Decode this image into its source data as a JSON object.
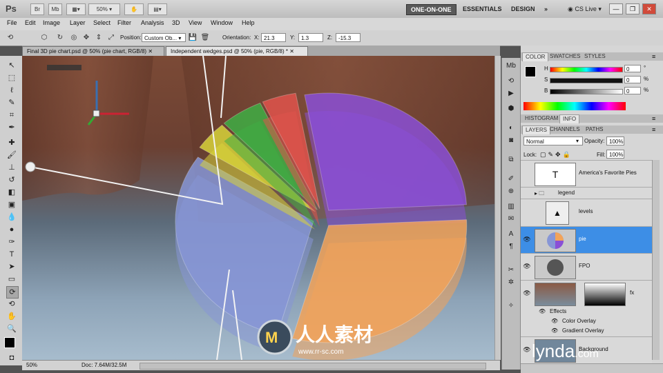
{
  "app": {
    "logo": "Ps",
    "zoom": "50%"
  },
  "appbar": {
    "left_buttons": [
      "Br",
      "Mb"
    ],
    "workspaces": [
      "ONE-ON-ONE",
      "ESSENTIALS",
      "DESIGN"
    ],
    "more": "»",
    "cslive": "CS Live"
  },
  "menu": [
    "File",
    "Edit",
    "Image",
    "Layer",
    "Select",
    "Filter",
    "Analysis",
    "3D",
    "View",
    "Window",
    "Help"
  ],
  "options": {
    "position_label": "Position:",
    "position_value": "Custom Ob...",
    "orientation_label": "Orientation:",
    "x_label": "X:",
    "x_value": "21.3",
    "y_label": "Y:",
    "y_value": "1.3",
    "z_label": "Z:",
    "z_value": "-15.3"
  },
  "tabs": [
    {
      "label": "Final 3D pie chart.psd @ 50% (pie chart, RGB/8)"
    },
    {
      "label": "Independent wedges.psd @ 50% (pie, RGB/8) *"
    }
  ],
  "status": {
    "zoom": "50%",
    "doc": "Doc: 7.64M/32.5M"
  },
  "color_panel": {
    "tabs": [
      "COLOR",
      "SWATCHES",
      "STYLES"
    ],
    "channels": [
      {
        "label": "H",
        "value": "0",
        "unit": "°"
      },
      {
        "label": "S",
        "value": "0",
        "unit": "%"
      },
      {
        "label": "B",
        "value": "0",
        "unit": "%"
      }
    ]
  },
  "histogram_tabs": [
    "HISTOGRAM",
    "INFO"
  ],
  "layers_panel": {
    "tabs": [
      "LAYERS",
      "CHANNELS",
      "PATHS"
    ],
    "blend_mode": "Normal",
    "opacity_label": "Opacity:",
    "opacity": "100%",
    "lock_label": "Lock:",
    "fill_label": "Fill:",
    "fill": "100%",
    "layers": [
      {
        "name": "America's Favorite Pies",
        "thumb": "T"
      },
      {
        "name": "legend",
        "type": "group"
      },
      {
        "name": "levels"
      },
      {
        "name": "pie",
        "selected": true
      },
      {
        "name": "FPO"
      },
      {
        "name": "Background"
      }
    ],
    "effects_label": "Effects",
    "effects": [
      "Color Overlay",
      "Gradient Overlay"
    ],
    "fx": "fx"
  },
  "watermark": {
    "brand": "lynda",
    "dotcom": ".com"
  },
  "chart_data": {
    "type": "pie",
    "title": "",
    "categories": [
      "purple",
      "orange",
      "blue",
      "yellow",
      "green",
      "red"
    ],
    "values": [
      27,
      30,
      30,
      4,
      5,
      4
    ],
    "colors": [
      "#8a4fd6",
      "#f2a35a",
      "#8796d6",
      "#d8d33a",
      "#3fae44",
      "#e0534c"
    ]
  }
}
